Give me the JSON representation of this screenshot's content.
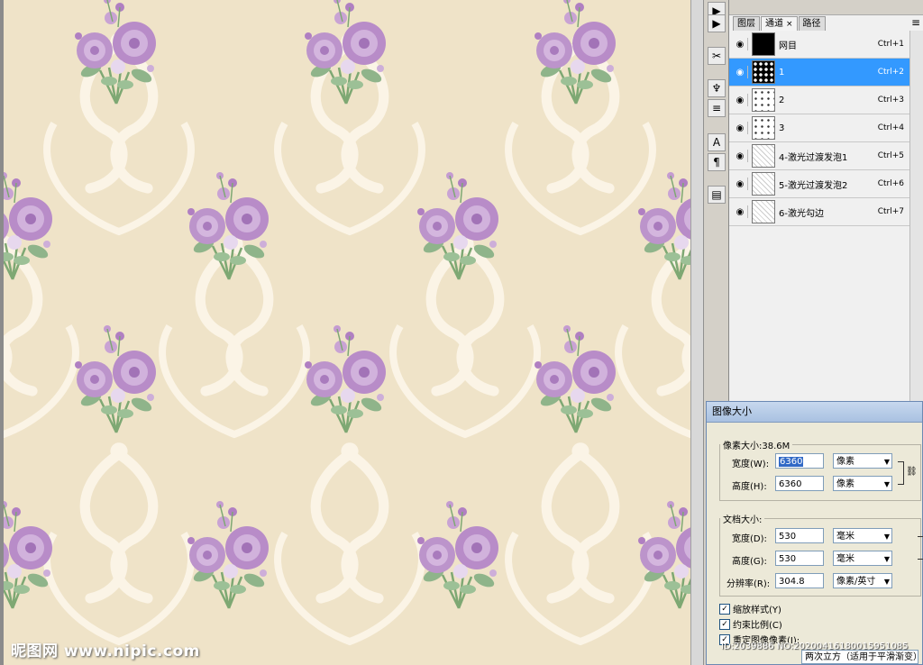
{
  "tools": [
    "history-icon",
    "actions-icon",
    "brush-presets-icon",
    "clone-source-icon",
    "tool-presets-icon",
    "character-icon",
    "paragraph-icon",
    "layer-comps-icon"
  ],
  "tool_glyphs": [
    "▶",
    "▶",
    "✂",
    "♆",
    "≡",
    "A",
    "¶",
    "▤"
  ],
  "panel": {
    "tabs": [
      {
        "label": "图层"
      },
      {
        "label": "通道",
        "close": "×"
      },
      {
        "label": "路径"
      }
    ],
    "menu_glyph": "≡",
    "channels": [
      {
        "name": "网目",
        "shortcut": "Ctrl+1",
        "thumb": "black",
        "selected": false
      },
      {
        "name": "1",
        "shortcut": "Ctrl+2",
        "thumb": "dots-dark",
        "selected": true
      },
      {
        "name": "2",
        "shortcut": "Ctrl+3",
        "thumb": "dots-light",
        "selected": false
      },
      {
        "name": "3",
        "shortcut": "Ctrl+4",
        "thumb": "dots-light",
        "selected": false
      },
      {
        "name": "4-激光过渡发泡1",
        "shortcut": "Ctrl+5",
        "thumb": "pattern",
        "selected": false
      },
      {
        "name": "5-激光过渡发泡2",
        "shortcut": "Ctrl+6",
        "thumb": "pattern",
        "selected": false
      },
      {
        "name": "6-激光勾边",
        "shortcut": "Ctrl+7",
        "thumb": "pattern",
        "selected": false
      }
    ]
  },
  "dialog": {
    "title": "图像大小",
    "pixel_size": "像素大小:38.6M",
    "width_label": "宽度(W):",
    "width_value": "6360",
    "width_unit": "像素",
    "height_label": "高度(H):",
    "height_value": "6360",
    "height_unit": "像素",
    "doc_size": "文档大小:",
    "doc_width_label": "宽度(D):",
    "doc_width_value": "530",
    "doc_width_unit": "毫米",
    "doc_height_label": "高度(G):",
    "doc_height_value": "530",
    "doc_height_unit": "毫米",
    "resolution_label": "分辨率(R):",
    "resolution_value": "304.8",
    "resolution_unit": "像素/英寸",
    "scale_styles": "缩放样式(Y)",
    "constrain": "约束比例(C)",
    "resample": "重定图像像素(I):",
    "resample_method": "两次立方（适用于平滑渐变）"
  },
  "watermark": {
    "left": "昵图网 www.nipic.com",
    "right": "ID:2039886 NO:20200416180015951085"
  },
  "colors": {
    "wallpaper": "#efe3c8",
    "rose": "#b88cc8",
    "leaf": "#8fb48a",
    "selection": "#3399ff"
  }
}
